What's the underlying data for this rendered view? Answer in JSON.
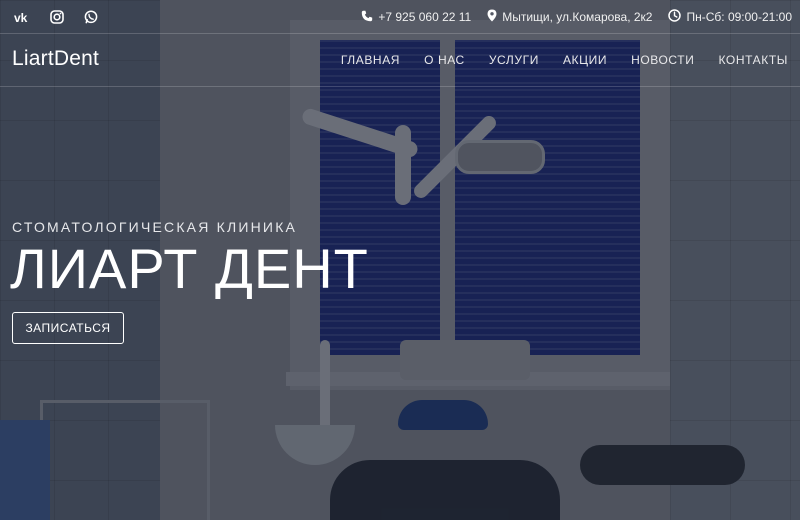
{
  "social": {
    "icons": [
      "vk-icon",
      "instagram-icon",
      "whatsapp-icon"
    ]
  },
  "contacts": {
    "phone": "+7 925 060 22 11",
    "address": "Мытищи, ул.Комарова, 2к2",
    "hours": "Пн-Сб: 09:00-21:00"
  },
  "logo": "LiartDent",
  "menu": [
    {
      "label": "ГЛАВНАЯ"
    },
    {
      "label": "О НАС"
    },
    {
      "label": "УСЛУГИ"
    },
    {
      "label": "АКЦИИ"
    },
    {
      "label": "НОВОСТИ"
    },
    {
      "label": "КОНТАКТЫ"
    }
  ],
  "hero": {
    "subtitle": "СТОМАТОЛОГИЧЕСКАЯ КЛИНИКА",
    "title": "ЛИАРТ ДЕНТ",
    "cta_label": "ЗАПИСАТЬСЯ"
  },
  "colors": {
    "text": "#ffffff",
    "window_blinds": "#1c2a78",
    "overlay": "#14182a"
  }
}
